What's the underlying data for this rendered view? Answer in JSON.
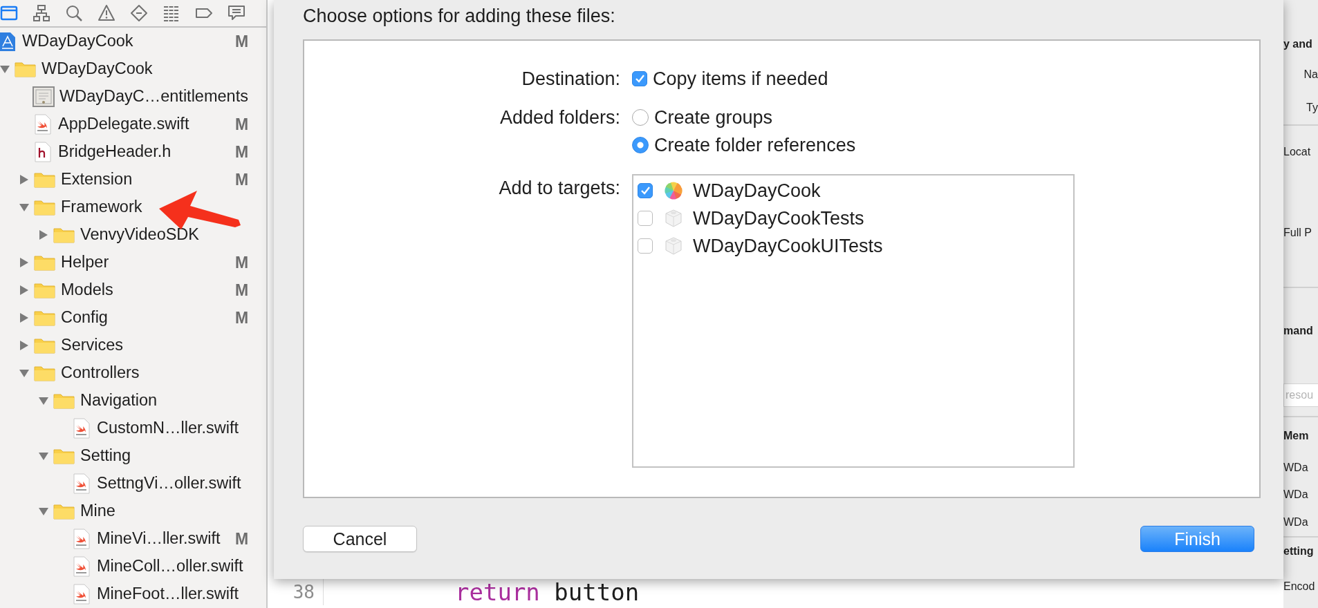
{
  "navigator_toolbar": {
    "icons": [
      {
        "kind": "folder",
        "selected": true
      },
      {
        "kind": "hierarchy",
        "selected": false
      },
      {
        "kind": "search",
        "selected": false
      },
      {
        "kind": "warning",
        "selected": false
      },
      {
        "kind": "test",
        "selected": false
      },
      {
        "kind": "list",
        "selected": false
      },
      {
        "kind": "tag",
        "selected": false
      },
      {
        "kind": "comment",
        "selected": false
      }
    ]
  },
  "sidebar": {
    "tree": [
      {
        "kind": "project",
        "label": "WDayDayCook",
        "badge": "M",
        "children": [
          {
            "kind": "folder",
            "label": "WDayDayCook",
            "expanded": true,
            "children": [
              {
                "kind": "entitlements",
                "label": "WDayDayC…entitlements"
              },
              {
                "kind": "swift",
                "label": "AppDelegate.swift",
                "badge": "M"
              },
              {
                "kind": "header",
                "label": "BridgeHeader.h",
                "badge": "M"
              },
              {
                "kind": "folder",
                "label": "Extension",
                "badge": "M",
                "expanded": false
              },
              {
                "kind": "folder",
                "label": "Framework",
                "expanded": true,
                "children": [
                  {
                    "kind": "folder",
                    "label": "VenvyVideoSDK",
                    "expanded": false
                  }
                ]
              },
              {
                "kind": "folder",
                "label": "Helper",
                "badge": "M",
                "expanded": false
              },
              {
                "kind": "folder",
                "label": "Models",
                "badge": "M",
                "expanded": false
              },
              {
                "kind": "folder",
                "label": "Config",
                "badge": "M",
                "expanded": false
              },
              {
                "kind": "folder",
                "label": "Services",
                "expanded": false
              },
              {
                "kind": "folder",
                "label": "Controllers",
                "expanded": true,
                "children": [
                  {
                    "kind": "folder",
                    "label": "Navigation",
                    "expanded": true,
                    "children": [
                      {
                        "kind": "swift",
                        "label": "CustomN…ller.swift"
                      }
                    ]
                  },
                  {
                    "kind": "folder",
                    "label": "Setting",
                    "expanded": true,
                    "children": [
                      {
                        "kind": "swift",
                        "label": "SettngVi…oller.swift"
                      }
                    ]
                  },
                  {
                    "kind": "folder",
                    "label": "Mine",
                    "expanded": true,
                    "children": [
                      {
                        "kind": "swift",
                        "label": "MineVi…ller.swift",
                        "badge": "M"
                      },
                      {
                        "kind": "swift",
                        "label": "MineColl…oller.swift"
                      },
                      {
                        "kind": "swift",
                        "label": "MineFoot…ller.swift"
                      }
                    ]
                  }
                ]
              }
            ]
          }
        ]
      }
    ]
  },
  "editor": {
    "lines": [
      {
        "number": "38",
        "tokens": [
          {
            "text": "return",
            "kind": "keyword"
          },
          {
            "text": "button",
            "kind": "plain"
          }
        ]
      }
    ]
  },
  "dialog": {
    "title": "Choose options for adding these files:",
    "destination": {
      "label": "Destination:",
      "option": {
        "label": "Copy items if needed",
        "checked": true
      }
    },
    "added_folders": {
      "label": "Added folders:",
      "options": [
        {
          "label": "Create groups",
          "selected": false
        },
        {
          "label": "Create folder references",
          "selected": true
        }
      ]
    },
    "targets": {
      "label": "Add to targets:",
      "items": [
        {
          "kind": "app",
          "label": "WDayDayCook",
          "checked": true
        },
        {
          "kind": "tests",
          "label": "WDayDayCookTests",
          "checked": false
        },
        {
          "kind": "tests",
          "label": "WDayDayCookUITests",
          "checked": false
        }
      ]
    },
    "buttons": [
      {
        "kind": "default",
        "label": "Cancel"
      },
      {
        "kind": "primary",
        "label": "Finish"
      }
    ]
  },
  "inspector": {
    "items": [
      {
        "kind": "heading",
        "text": "y and"
      },
      {
        "kind": "label",
        "text": "Na"
      },
      {
        "kind": "label",
        "text": "Ty"
      },
      {
        "kind": "label",
        "text": "Locat"
      },
      {
        "kind": "label",
        "text": "Full P"
      },
      {
        "kind": "heading",
        "text": "mand"
      },
      {
        "kind": "field",
        "placeholder": "resou"
      },
      {
        "kind": "heading",
        "text": "Mem"
      },
      {
        "kind": "label",
        "text": "WDa"
      },
      {
        "kind": "label",
        "text": "WDa"
      },
      {
        "kind": "label",
        "text": "WDa"
      },
      {
        "kind": "heading",
        "text": "etting"
      },
      {
        "kind": "label",
        "text": "Encod"
      }
    ]
  }
}
